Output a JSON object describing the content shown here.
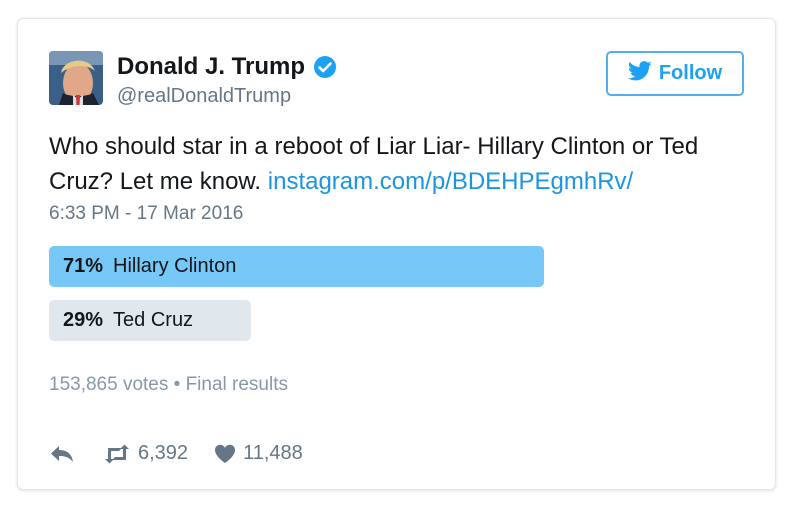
{
  "tweet": {
    "author_name": "Donald J. Trump",
    "author_handle": "@realDonaldTrump",
    "follow_label": "Follow",
    "text": "Who should star in a reboot of Liar Liar- Hillary Clinton or Ted Cruz? Let me know. ",
    "link_text": "instagram.com/p/BDEHPEgmhRv/",
    "timestamp": "6:33 PM - 17 Mar 2016"
  },
  "poll": {
    "options": [
      {
        "percent_label": "71%",
        "percent": 71,
        "label": "Hillary Clinton",
        "color": "#77c7f7"
      },
      {
        "percent_label": "29%",
        "percent": 29,
        "label": "Ted Cruz",
        "color": "#e1e8ed"
      }
    ],
    "meta": "153,865 votes • Final results"
  },
  "actions": {
    "retweet_count": "6,392",
    "like_count": "11,488"
  },
  "colors": {
    "accent": "#1da1f2",
    "link": "#1b95e0",
    "verified": "#1da1f2",
    "muted": "#657786"
  },
  "icons": [
    "verified-badge-icon",
    "twitter-bird-icon",
    "reply-icon",
    "retweet-icon",
    "heart-icon"
  ]
}
